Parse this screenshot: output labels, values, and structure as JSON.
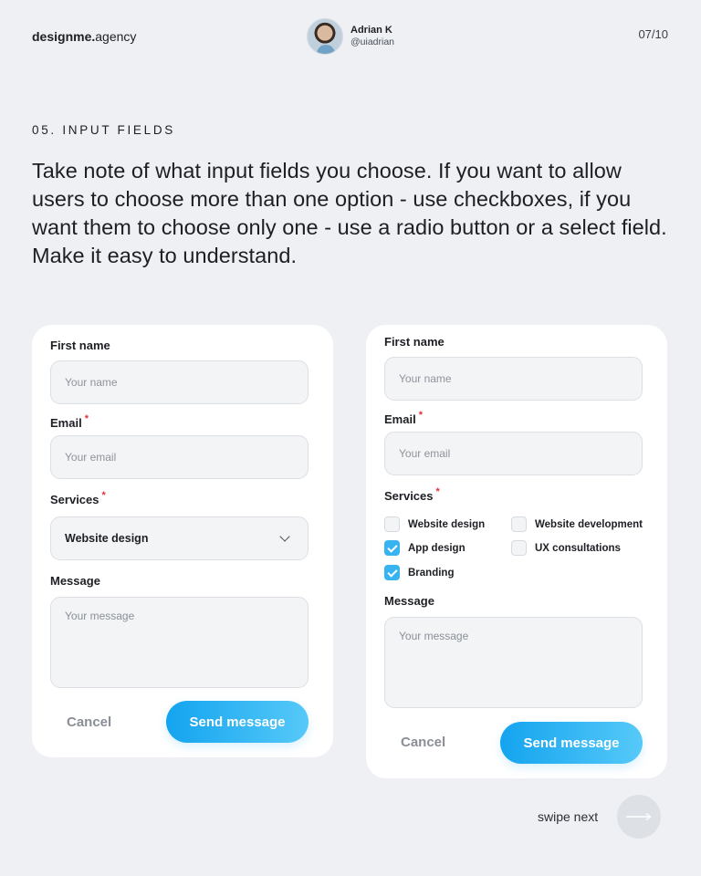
{
  "header": {
    "brand_bold": "designme.",
    "brand_light": "agency",
    "author_name": "Adrian K",
    "author_handle": "@uiadrian",
    "page_number": "07/10"
  },
  "section": {
    "label": "05. INPUT FIELDS",
    "body": "Take note of what input fields you choose. If you want to allow users to choose more than one option - use checkboxes, if you want them to choose only one - use a radio button or a select field. Make it easy to understand."
  },
  "left_form": {
    "first_name_label": "First name",
    "first_name_placeholder": "Your name",
    "email_label": "Email",
    "email_required": "*",
    "email_placeholder": "Your email",
    "services_label": "Services",
    "services_required": "*",
    "services_selected": "Website design",
    "message_label": "Message",
    "message_placeholder": "Your message",
    "cancel_label": "Cancel",
    "send_label": "Send message"
  },
  "right_form": {
    "first_name_label": "First name",
    "first_name_placeholder": "Your name",
    "email_label": "Email",
    "email_required": "*",
    "email_placeholder": "Your email",
    "services_label": "Services",
    "services_required": "*",
    "options": [
      {
        "label": "Website design",
        "checked": false
      },
      {
        "label": "App design",
        "checked": true
      },
      {
        "label": "Branding",
        "checked": true
      },
      {
        "label": "Website development",
        "checked": false
      },
      {
        "label": "UX consultations",
        "checked": false
      }
    ],
    "message_label": "Message",
    "message_placeholder": "Your message",
    "cancel_label": "Cancel",
    "send_label": "Send message"
  },
  "footer": {
    "swipe_label": "swipe next"
  },
  "colors": {
    "background": "#eef0f3",
    "accent_start": "#14a4ef",
    "accent_end": "#56c9f8",
    "checkbox_checked": "#36b3f0",
    "required": "#e0323c"
  }
}
